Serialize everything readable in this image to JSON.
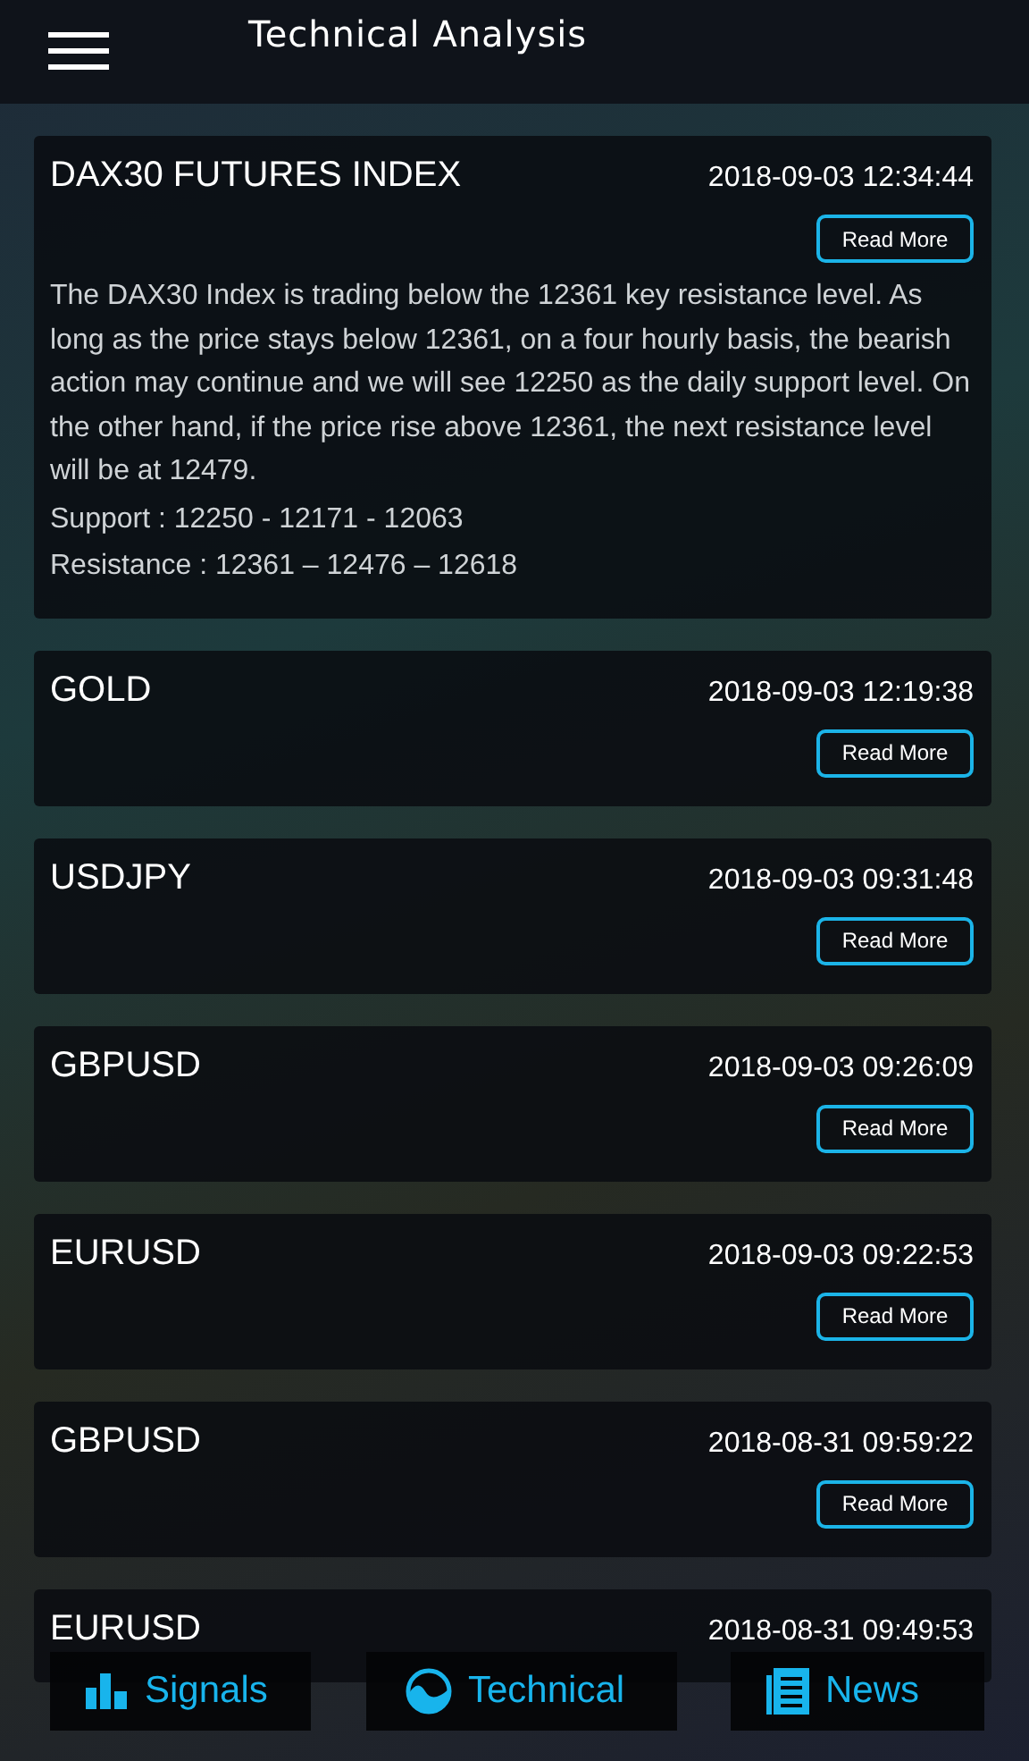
{
  "header": {
    "title": "Technical Analysis"
  },
  "cards": [
    {
      "title": "DAX30 FUTURES INDEX",
      "time": "2018-09-03 12:34:44",
      "button": "Read More",
      "paragraphs": [
        "The DAX30 Index is trading below the 12361 key resistance level. As long as the price stays below 12361, on a four hourly basis, the bearish action may continue and we will see 12250 as the daily support level. On the other hand, if the price rise above 12361, the next resistance level will be at 12479.",
        "Support : 12250 - 12171 - 12063",
        "Resistance : 12361 – 12476 – 12618"
      ]
    },
    {
      "title": "GOLD",
      "time": "2018-09-03 12:19:38",
      "button": "Read More"
    },
    {
      "title": "USDJPY",
      "time": "2018-09-03 09:31:48",
      "button": "Read More"
    },
    {
      "title": "GBPUSD",
      "time": "2018-09-03 09:26:09",
      "button": "Read More"
    },
    {
      "title": "EURUSD",
      "time": "2018-09-03 09:22:53",
      "button": "Read More"
    },
    {
      "title": "GBPUSD",
      "time": "2018-08-31 09:59:22",
      "button": "Read More"
    },
    {
      "title": "EURUSD",
      "time": "2018-08-31 09:49:53"
    }
  ],
  "nav": [
    {
      "kind": "signals",
      "label": "Signals"
    },
    {
      "kind": "technical",
      "label": "Technical"
    },
    {
      "kind": "news",
      "label": "News"
    }
  ]
}
